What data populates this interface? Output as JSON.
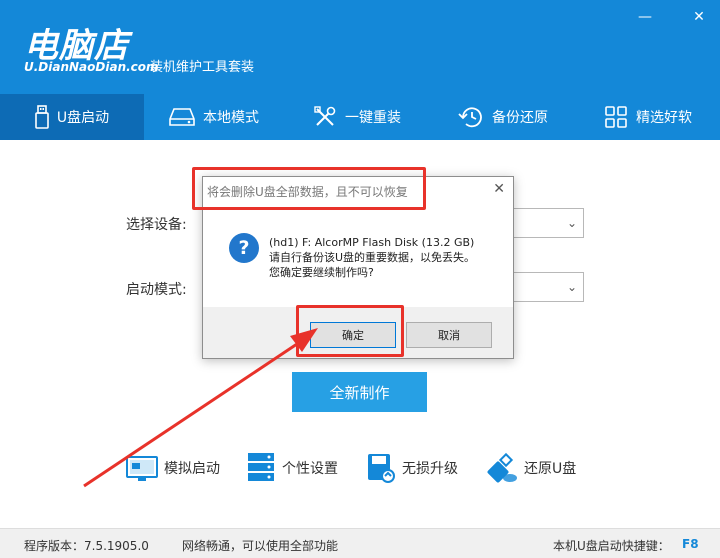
{
  "header": {
    "logo_main": "电脑店",
    "logo_sub": "U.DianNaoDian.com",
    "tagline": "装机维护工具套装",
    "minimize": "—",
    "close": "✕"
  },
  "nav": [
    {
      "label": "U盘启动",
      "icon": "usb-icon"
    },
    {
      "label": "本地模式",
      "icon": "hard-disk-icon"
    },
    {
      "label": "一键重装",
      "icon": "tools-icon"
    },
    {
      "label": "备份还原",
      "icon": "restore-icon"
    },
    {
      "label": "精选好软",
      "icon": "grid-icon"
    }
  ],
  "form": {
    "device_label": "选择设备:",
    "mode_label": "启动模式:"
  },
  "make_button": "全新制作",
  "tools": [
    {
      "label": "模拟启动",
      "icon": "monitor-icon"
    },
    {
      "label": "个性设置",
      "icon": "server-icon"
    },
    {
      "label": "无损升级",
      "icon": "save-upgrade-icon"
    },
    {
      "label": "还原U盘",
      "icon": "usb-restore-icon"
    }
  ],
  "status": {
    "version": "程序版本：7.5.1905.0",
    "network": "网络畅通，可以使用全部功能",
    "hotkey_label": "本机U盘启动快捷键：",
    "hotkey": "F8"
  },
  "dialog": {
    "title": "将会删除U盘全部数据，且不可以恢复",
    "close": "✕",
    "question": "?",
    "line1": "(hd1) F: AlcorMP Flash Disk (13.2 GB)",
    "line2": "请自行备份该U盘的重要数据，以免丢失。",
    "line3": "您确定要继续制作吗?",
    "ok": "确定",
    "cancel": "取消"
  },
  "colors": {
    "brand": "#1488d8",
    "nav_active": "#0d6bb5",
    "button": "#27a0e4",
    "highlight": "#e8322a",
    "hotkey": "#1488d8"
  }
}
